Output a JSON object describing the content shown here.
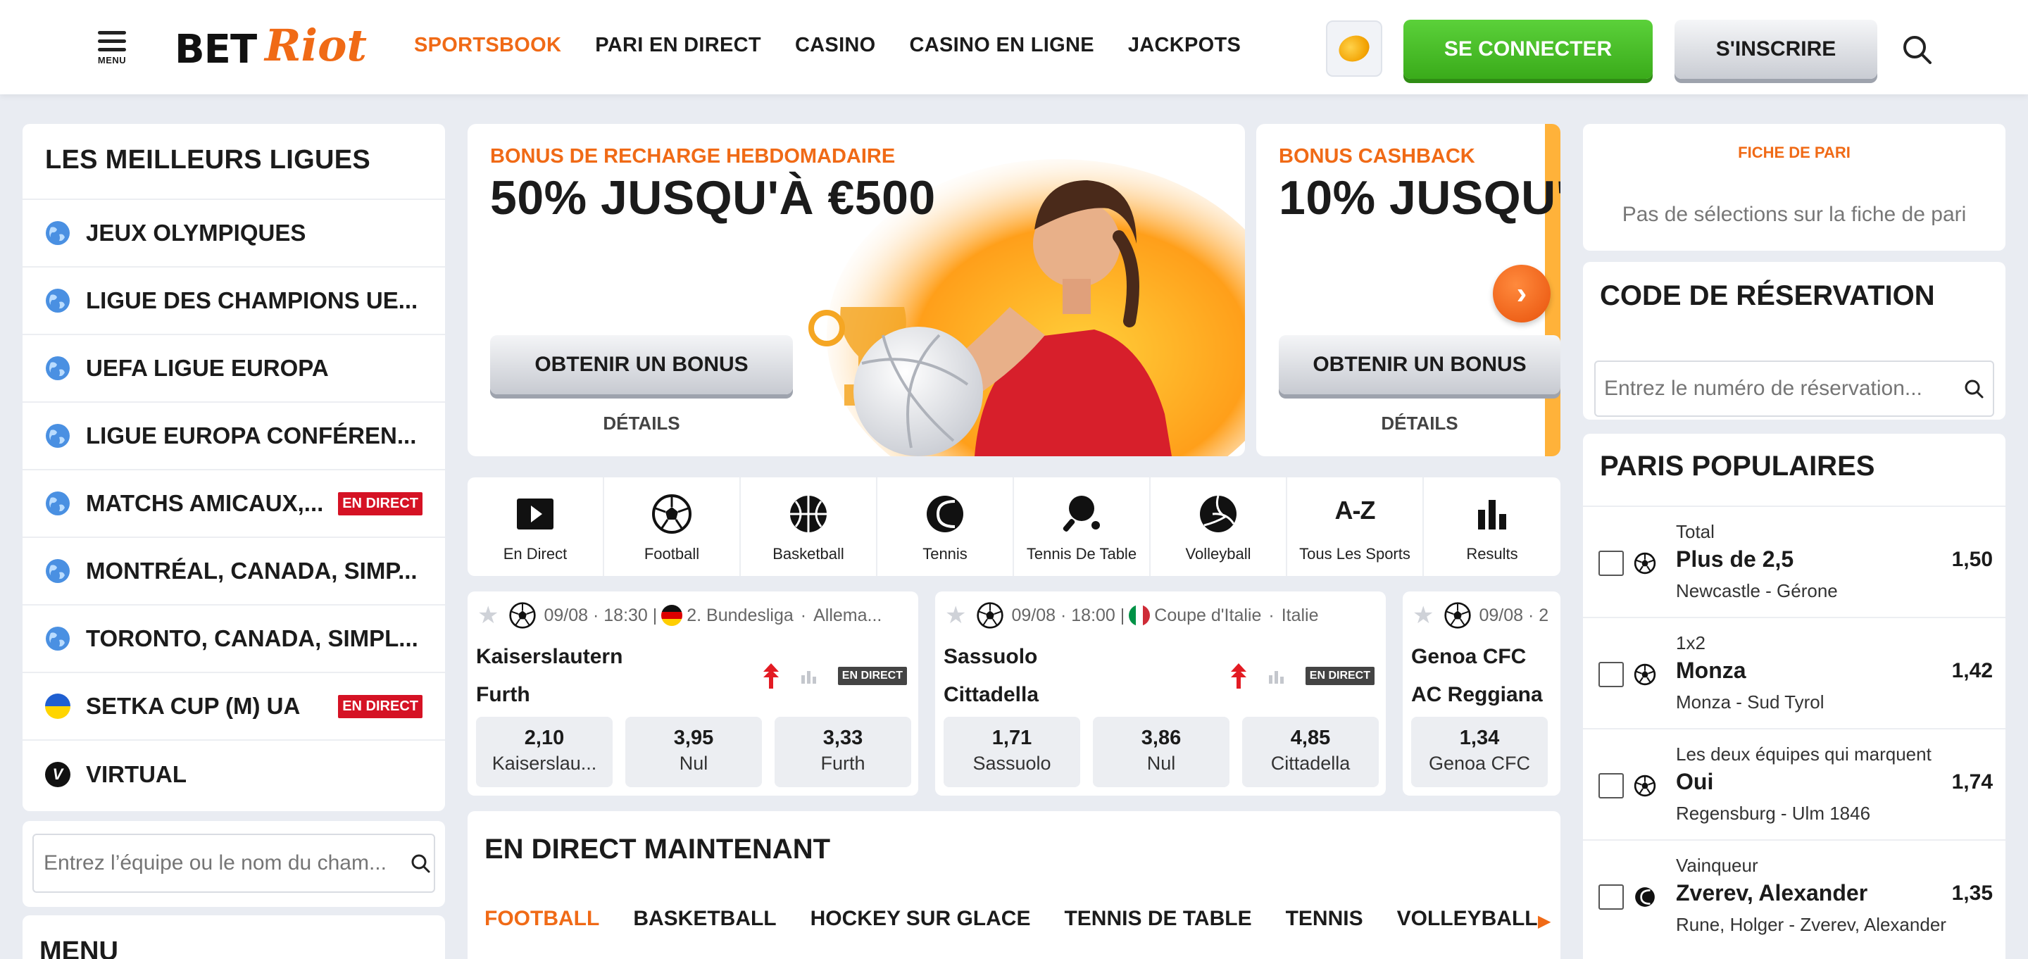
{
  "header": {
    "menu_label": "MENU",
    "logo_bet": "BET",
    "logo_riot": "Riot",
    "nav": [
      "SPORTSBOOK",
      "PARI EN DIRECT",
      "CASINO",
      "CASINO EN LIGNE",
      "JACKPOTS"
    ],
    "login": "SE CONNECTER",
    "register": "S'INSCRIRE"
  },
  "leagues": {
    "title": "LES MEILLEURS LIGUES",
    "items": [
      {
        "name": "JEUX OLYMPIQUES",
        "live": ""
      },
      {
        "name": "LIGUE DES CHAMPIONS UE...",
        "live": ""
      },
      {
        "name": "UEFA LIGUE EUROPA",
        "live": ""
      },
      {
        "name": "LIGUE EUROPA CONFÉREN...",
        "live": ""
      },
      {
        "name": "MATCHS AMICAUX,...",
        "live": "EN DIRECT"
      },
      {
        "name": "MONTRÉAL, CANADA, SIMP...",
        "live": ""
      },
      {
        "name": "TORONTO, CANADA, SIMPL...",
        "live": ""
      },
      {
        "name": "SETKA CUP (M) UA",
        "live": "EN DIRECT"
      },
      {
        "name": "VIRTUAL",
        "live": ""
      }
    ],
    "search_placeholder": "Entrez l’équipe ou le nom du cham...",
    "menu_title": "MENU"
  },
  "banners": [
    {
      "kicker": "BONUS DE RECHARGE HEBDOMADAIRE",
      "headline": "50% JUSQU'À €500",
      "button": "OBTENIR UN BONUS",
      "details": "DÉTAILS"
    },
    {
      "kicker": "BONUS CASHBACK",
      "headline": "10% JUSQU'",
      "button": "OBTENIR UN BONUS",
      "details": "DÉTAILS"
    }
  ],
  "sports": [
    "En Direct",
    "Football",
    "Basketball",
    "Tennis",
    "Tennis De Table",
    "Volleyball",
    "Tous Les Sports",
    "Results"
  ],
  "sports_az": "A-Z",
  "matches": [
    {
      "time": "09/08 · 18:30 |",
      "league": "2. Bundesliga",
      "country": "Allema...",
      "team1": "Kaiserslautern",
      "team2": "Furth",
      "live": "EN DIRECT",
      "odds": [
        {
          "v": "2,10",
          "l": "Kaiserslau..."
        },
        {
          "v": "3,95",
          "l": "Nul"
        },
        {
          "v": "3,33",
          "l": "Furth"
        }
      ]
    },
    {
      "time": "09/08 · 18:00 |",
      "league": "Coupe d'Italie",
      "country": "Italie",
      "team1": "Sassuolo",
      "team2": "Cittadella",
      "live": "EN DIRECT",
      "odds": [
        {
          "v": "1,71",
          "l": "Sassuolo"
        },
        {
          "v": "3,86",
          "l": "Nul"
        },
        {
          "v": "4,85",
          "l": "Cittadella"
        }
      ]
    },
    {
      "time": "09/08 · 2",
      "team1": "Genoa CFC",
      "team2": "AC Reggiana",
      "odds": [
        {
          "v": "1,34",
          "l": "Genoa CFC"
        }
      ]
    }
  ],
  "live_now": {
    "title": "EN DIRECT MAINTENANT",
    "tabs": [
      "FOOTBALL",
      "BASKETBALL",
      "HOCKEY SUR GLACE",
      "TENNIS DE TABLE",
      "TENNIS",
      "VOLLEYBALL"
    ]
  },
  "betslip": {
    "title": "FICHE DE PARI",
    "empty": "Pas de sélections sur la fiche de pari"
  },
  "booking": {
    "title": "CODE DE RÉSERVATION",
    "placeholder": "Entrez le numéro de réservation..."
  },
  "popular": {
    "title": "PARIS POPULAIRES",
    "items": [
      {
        "market": "Total",
        "selection": "Plus de 2,5",
        "odd": "1,50",
        "home": "Newcastle",
        "away": "Gérone",
        "sport_icon": "football-icon"
      },
      {
        "market": "1x2",
        "selection": "Monza",
        "odd": "1,42",
        "home": "Monza",
        "away": "Sud Tyrol",
        "sport_icon": "football-icon"
      },
      {
        "market": "Les deux équipes qui marquent",
        "selection": "Oui",
        "odd": "1,74",
        "home": "Regensburg",
        "away": "Ulm 1846",
        "sport_icon": "football-icon"
      },
      {
        "market": "Vainqueur",
        "selection": "Zverev, Alexander",
        "odd": "1,35",
        "home": "Rune, Holger",
        "away": "Zverev, Alexander",
        "sport_icon": "tennis-icon"
      }
    ]
  },
  "colors": {
    "accent": "#f06a16",
    "login_green": "#3aab1a",
    "live_red": "#d51224",
    "background": "#e9ecf2"
  }
}
